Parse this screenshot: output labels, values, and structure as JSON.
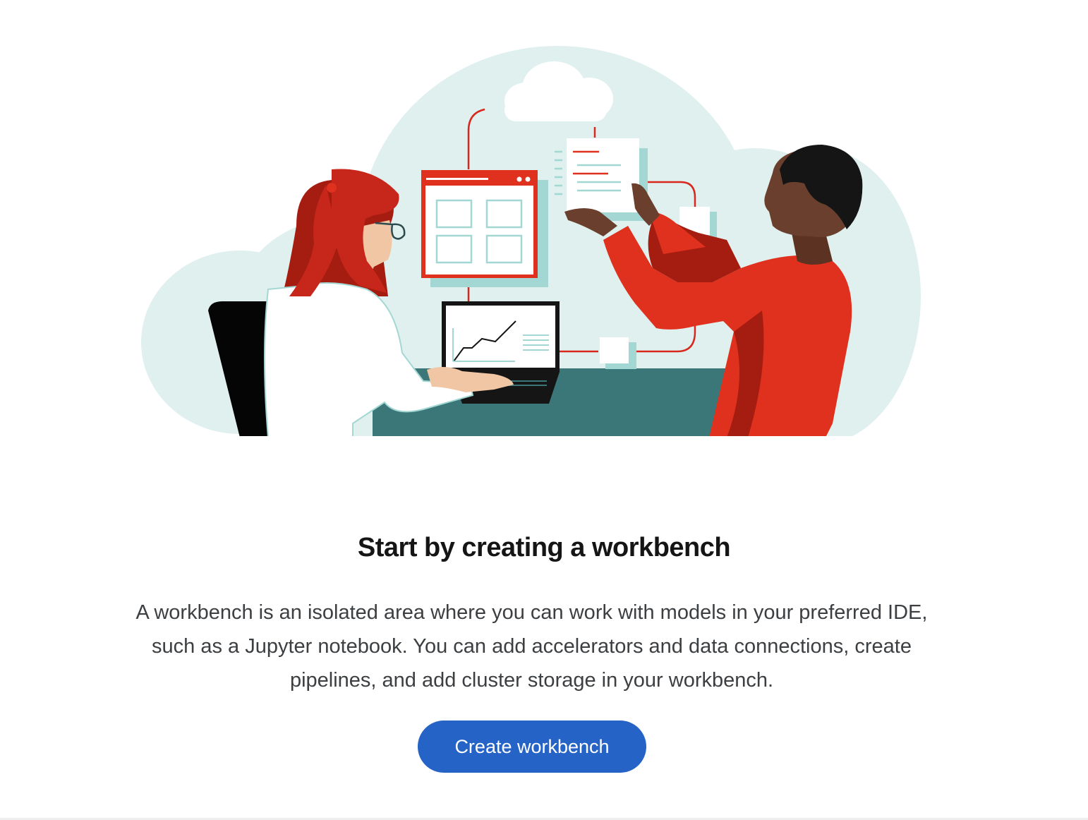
{
  "empty_state": {
    "illustration_name": "workbench-illustration",
    "title": "Start by creating a workbench",
    "description": "A workbench is an isolated area where you can work with models in your preferred IDE, such as a Jupyter notebook. You can add accelerators and data connections, create pipelines, and add cluster storage in your workbench.",
    "primary_button_label": "Create workbench"
  },
  "colors": {
    "accent_blue": "#2563c7",
    "brand_red": "#e0311f",
    "cloud_bg": "#dff0ef",
    "desk_teal": "#3b7778"
  }
}
